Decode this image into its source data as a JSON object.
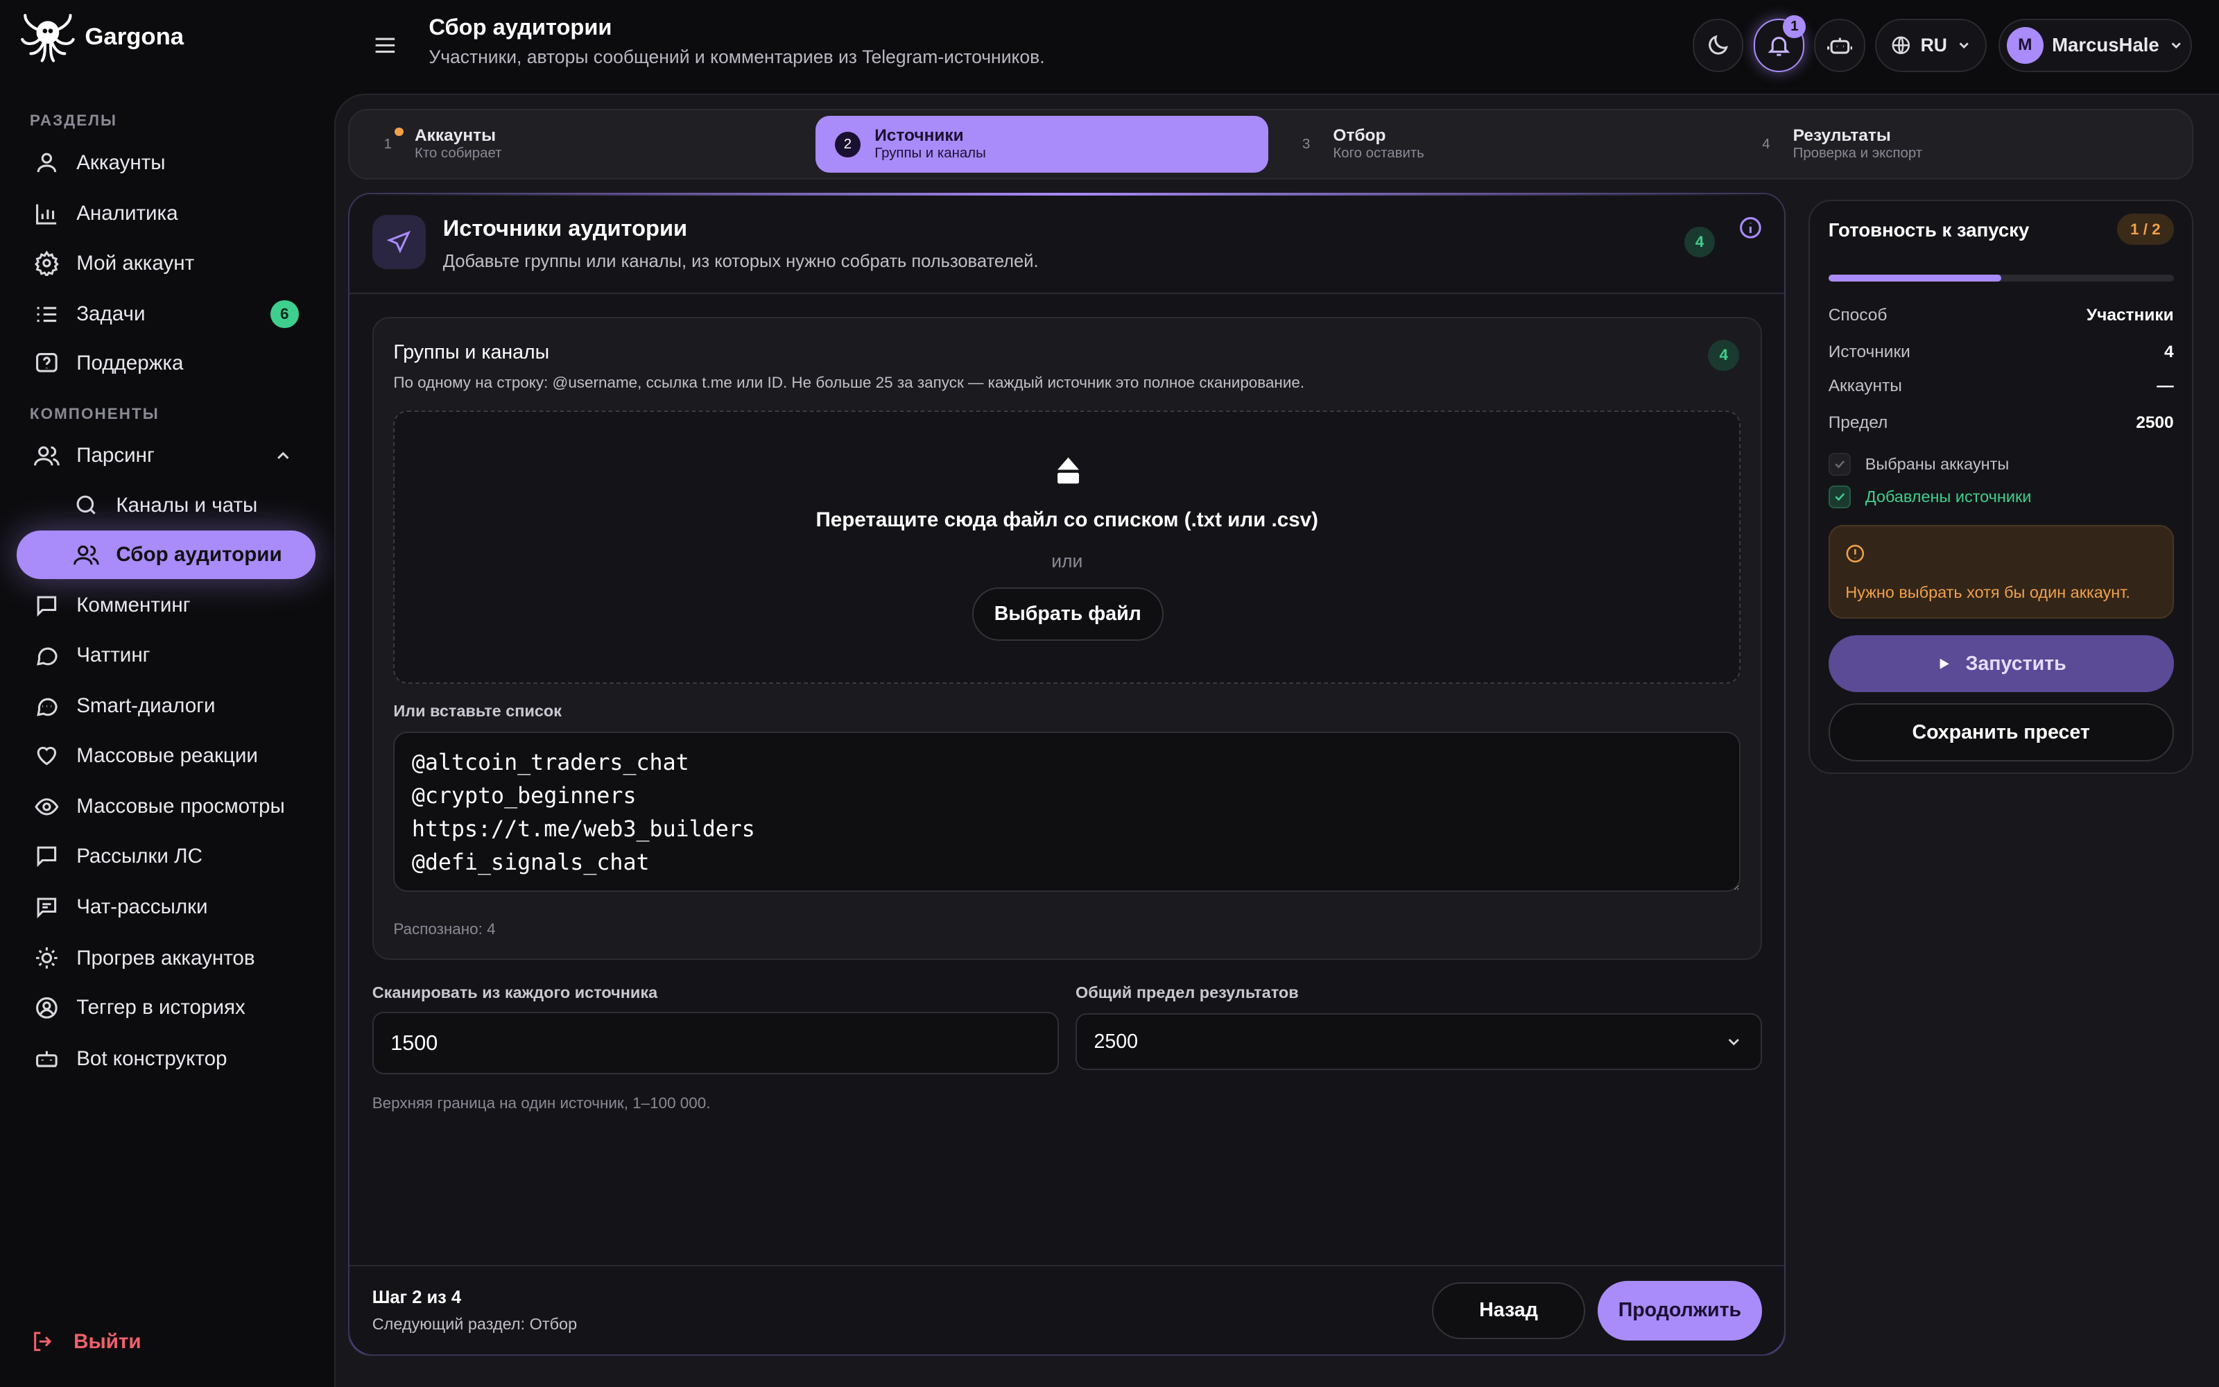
{
  "brand": {
    "name": "Gargona"
  },
  "header": {
    "title": "Сбор аудитории",
    "subtitle": "Участники, авторы сообщений и комментариев из Telegram-источников."
  },
  "topbar": {
    "notifications_count": "1",
    "language": "RU",
    "user_initial": "M",
    "user_name": "MarcusHale"
  },
  "sidebar": {
    "section_1": "РАЗДЕЛЫ",
    "section_2": "КОМПОНЕНТЫ",
    "items": [
      {
        "label": "Аккаунты",
        "icon": "user-icon"
      },
      {
        "label": "Аналитика",
        "icon": "bar-chart-icon"
      },
      {
        "label": "Мой аккаунт",
        "icon": "gear-icon"
      },
      {
        "label": "Задачи",
        "icon": "list-icon",
        "badge": "6"
      },
      {
        "label": "Поддержка",
        "icon": "help-icon"
      }
    ],
    "parsing": {
      "label": "Парсинг",
      "children": [
        "Каналы и чаты",
        "Сбор аудитории"
      ]
    },
    "components": [
      {
        "label": "Комментинг",
        "icon": "comment-icon"
      },
      {
        "label": "Чаттинг",
        "icon": "chat-bubble-icon"
      },
      {
        "label": "Smart-диалоги",
        "icon": "dots-bubble-icon"
      },
      {
        "label": "Массовые реакции",
        "icon": "heart-icon"
      },
      {
        "label": "Массовые просмотры",
        "icon": "eye-icon"
      },
      {
        "label": "Рассылки ЛС",
        "icon": "message-square-icon"
      },
      {
        "label": "Чат-рассылки",
        "icon": "message-lines-icon"
      },
      {
        "label": "Прогрев аккаунтов",
        "icon": "sun-icon"
      },
      {
        "label": "Теггер в историях",
        "icon": "at-icon"
      },
      {
        "label": "Bot конструктор",
        "icon": "bot-icon"
      }
    ],
    "logout": "Выйти"
  },
  "steps": [
    {
      "num": "1",
      "title": "Аккаунты",
      "sub": "Кто собирает"
    },
    {
      "num": "2",
      "title": "Источники",
      "sub": "Группы и каналы"
    },
    {
      "num": "3",
      "title": "Отбор",
      "sub": "Кого оставить"
    },
    {
      "num": "4",
      "title": "Результаты",
      "sub": "Проверка и экспорт"
    }
  ],
  "sources_card": {
    "title": "Источники аудитории",
    "subtitle": "Добавьте группы или каналы, из которых нужно собрать пользователей.",
    "count": "4",
    "groups": {
      "title": "Группы и каналы",
      "hint": "По одному на строку: @username, ссылка t.me или ID. Не больше 25 за запуск — каждый источник это полное сканирование.",
      "count": "4",
      "drop_text": "Перетащите сюда файл со списком (.txt или .csv)",
      "or": "или",
      "choose_file": "Выбрать файл",
      "paste_label": "Или вставьте список",
      "list": "@altcoin_traders_chat\n@crypto_beginners\nhttps://t.me/web3_builders\n@defi_signals_chat",
      "recognized": "Распознано: 4"
    },
    "scan_label": "Сканировать из каждого источника",
    "scan_value": "1500",
    "scan_hint": "Верхняя граница на один источник, 1–100 000.",
    "limit_label": "Общий предел результатов",
    "limit_value": "2500"
  },
  "footer": {
    "step": "Шаг 2 из 4",
    "next": "Следующий раздел: Отбор",
    "back": "Назад",
    "continue": "Продолжить"
  },
  "readiness": {
    "title": "Готовность к запуску",
    "badge": "1 / 2",
    "progress": 0.5,
    "rows": [
      {
        "k": "Способ",
        "v": "Участники"
      },
      {
        "k": "Источники",
        "v": "4"
      },
      {
        "k": "Аккаунты",
        "v": "—"
      },
      {
        "k": "Предел",
        "v": "2500"
      }
    ],
    "checks": [
      {
        "label": "Выбраны аккаунты",
        "done": false
      },
      {
        "label": "Добавлены источники",
        "done": true
      }
    ],
    "warning": "Нужно выбрать хотя бы один аккаунт.",
    "run": "Запустить",
    "save_preset": "Сохранить пресет"
  },
  "colors": {
    "accent": "#a98bfa",
    "success": "#3ecf8e",
    "danger": "#f0606c",
    "warning": "#f0a04b"
  }
}
